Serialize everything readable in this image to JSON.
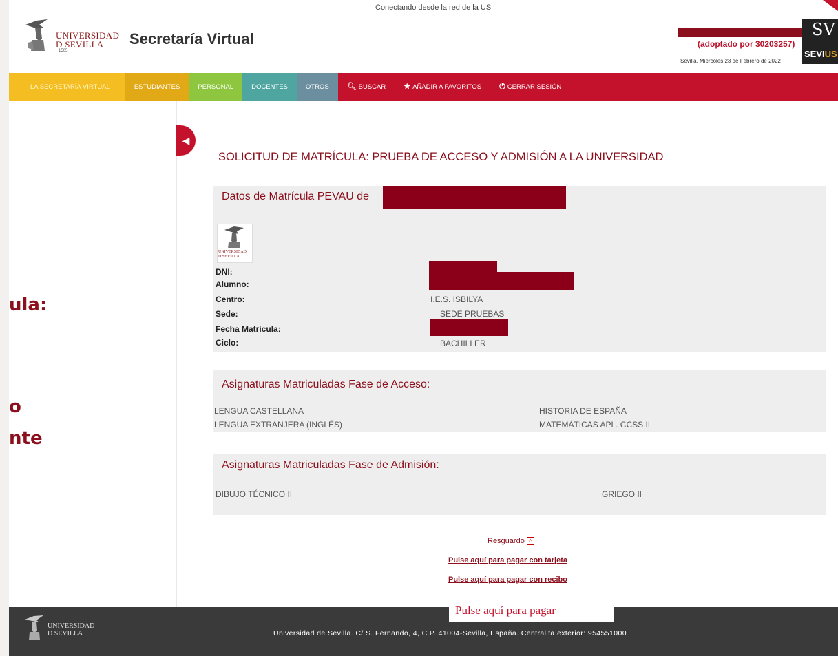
{
  "header": {
    "connection_notice": "Conectando desde la red de la US",
    "logo_line1": "UNIVERSIDAD",
    "logo_line2": "D SEVILLA",
    "logo_year": "1505",
    "app_title": "Secretaría Virtual",
    "adopted_by": "(adoptado por 30203257)",
    "date": "Sevilla, Miercoles 23 de Febrero de 2022",
    "sv_logo_top": "SV",
    "sv_logo_bottom_a": "SEVI",
    "sv_logo_bottom_b": "US"
  },
  "nav": {
    "items": [
      {
        "label": "LA SECRETARÍA VIRTUAL"
      },
      {
        "label": "ESTUDIANTES"
      },
      {
        "label": "PERSONAL"
      },
      {
        "label": "DOCENTES"
      },
      {
        "label": "OTROS"
      },
      {
        "label": "BUSCAR",
        "icon": "search-icon"
      },
      {
        "label": "AÑADIR A FAVORITOS",
        "icon": "star-icon"
      },
      {
        "label": "CERRAR SESIÓN",
        "icon": "power-icon"
      }
    ]
  },
  "overlay_left": {
    "line1": "ula:",
    "line2": "o",
    "line3": "nte"
  },
  "main": {
    "page_heading": "SOLICITUD DE MATRÍCULA: PRUEBA DE ACCESO Y ADMISIÓN A LA UNIVERSIDAD",
    "datos": {
      "heading": "Datos de Matrícula PEVAU de",
      "crest_line1": "UNIVERSIDAD",
      "crest_line2": "D SEVILLA",
      "fields": [
        {
          "label": "DNI:",
          "value": ""
        },
        {
          "label": "Alumno:",
          "value": ""
        },
        {
          "label": "Centro:",
          "value": "I.E.S. ISBILYA"
        },
        {
          "label": "Sede:",
          "value": "SEDE PRUEBAS"
        },
        {
          "label": "Fecha Matrícula:",
          "value": ""
        },
        {
          "label": "Ciclo:",
          "value": "BACHILLER"
        }
      ]
    },
    "acceso": {
      "heading": "Asignaturas Matriculadas Fase de Acceso:",
      "subjects": [
        "LENGUA CASTELLANA",
        "HISTORIA DE ESPAÑA",
        "LENGUA EXTRANJERA (INGLÉS)",
        "MATEMÁTICAS APL. CCSS II"
      ]
    },
    "admision": {
      "heading": "Asignaturas Matriculadas Fase de Admisión:",
      "subjects": [
        "DIBUJO TÉCNICO II",
        "GRIEGO II"
      ]
    },
    "links": {
      "resguardo": "Resguardo",
      "pay_card": "Pulse aquí para pagar con tarjeta",
      "pay_receipt": "Pulse aquí para pagar con recibo",
      "pay_overlay": "Pulse aquí para pagar"
    }
  },
  "footer": {
    "logo_line1": "UNIVERSIDAD",
    "logo_line2": "D SEVILLA",
    "address": "Universidad de Sevilla. C/ S. Fernando, 4, C.P. 41004-Sevilla, España. Centralita exterior: 954551000"
  },
  "colors": {
    "brand_red": "#c4122c",
    "dark_red": "#8b0f1c",
    "nav_yellow": "#f4be22",
    "nav_green": "#8ec63f",
    "nav_teal": "#4fa6a1",
    "nav_slate": "#6c8fa0"
  }
}
